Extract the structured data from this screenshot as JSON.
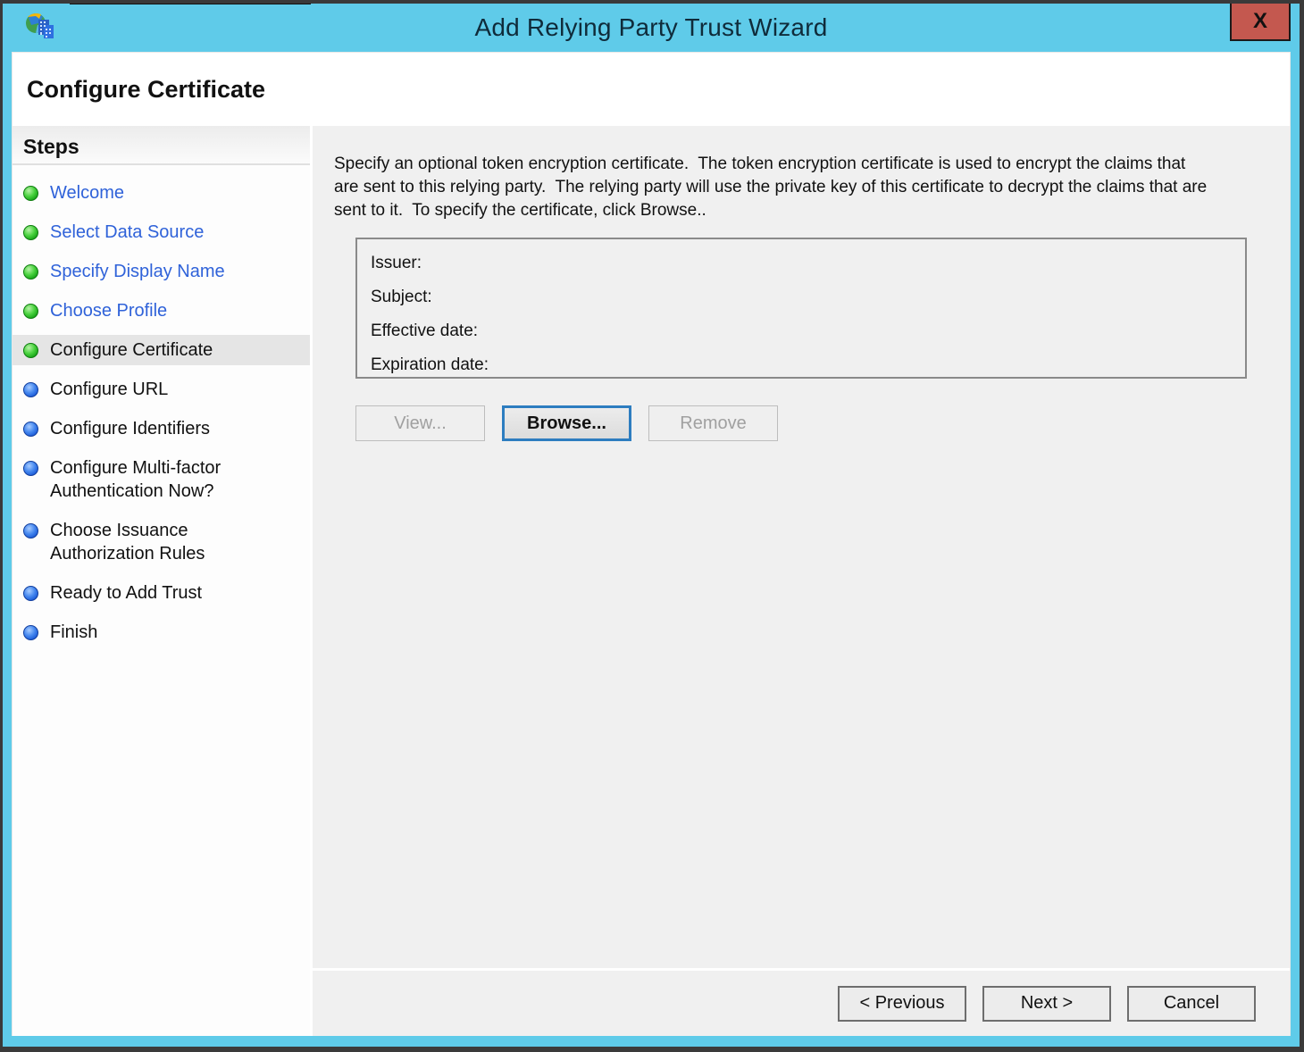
{
  "window": {
    "title": "Add Relying Party Trust Wizard",
    "close_label": "X",
    "page_heading": "Configure Certificate",
    "icon": "adfs-wizard-icon",
    "colors": {
      "titlebar_blue": "#5FCBE9",
      "close_button_red": "#C4584F",
      "link_blue": "#2F62D9",
      "bullet_green": "#1AA51A",
      "bullet_blue": "#1D5CD8",
      "content_bg": "#F0F0F0",
      "current_step_highlight": "#E5E5E5"
    }
  },
  "steps": {
    "heading": "Steps",
    "items": [
      {
        "label": "Welcome",
        "bullet": "green",
        "state": "completed"
      },
      {
        "label": "Select Data Source",
        "bullet": "green",
        "state": "completed"
      },
      {
        "label": "Specify Display Name",
        "bullet": "green",
        "state": "completed"
      },
      {
        "label": "Choose Profile",
        "bullet": "green",
        "state": "completed"
      },
      {
        "label": "Configure Certificate",
        "bullet": "green",
        "state": "current"
      },
      {
        "label": "Configure URL",
        "bullet": "blue",
        "state": "upcoming"
      },
      {
        "label": "Configure Identifiers",
        "bullet": "blue",
        "state": "upcoming"
      },
      {
        "label": "Configure Multi-factor Authentication Now?",
        "bullet": "blue",
        "state": "upcoming"
      },
      {
        "label": "Choose Issuance Authorization Rules",
        "bullet": "blue",
        "state": "upcoming"
      },
      {
        "label": "Ready to Add Trust",
        "bullet": "blue",
        "state": "upcoming"
      },
      {
        "label": "Finish",
        "bullet": "blue",
        "state": "upcoming"
      }
    ]
  },
  "content": {
    "description": "Specify an optional token encryption certificate.  The token encryption certificate is used to encrypt the claims that are sent to this relying party.  The relying party will use the private key of this certificate to decrypt the claims that are sent to it.  To specify the certificate, click Browse..",
    "certificate": {
      "fields": [
        {
          "label": "Issuer:",
          "value": ""
        },
        {
          "label": "Subject:",
          "value": ""
        },
        {
          "label": "Effective date:",
          "value": ""
        },
        {
          "label": "Expiration date:",
          "value": ""
        }
      ]
    },
    "buttons": [
      {
        "label": "View...",
        "enabled": false
      },
      {
        "label": "Browse...",
        "enabled": true,
        "focused": true
      },
      {
        "label": "Remove",
        "enabled": false
      }
    ]
  },
  "footer": {
    "buttons": [
      {
        "label": "< Previous",
        "enabled": true
      },
      {
        "label": "Next >",
        "enabled": true
      },
      {
        "label": "Cancel",
        "enabled": true
      }
    ]
  }
}
